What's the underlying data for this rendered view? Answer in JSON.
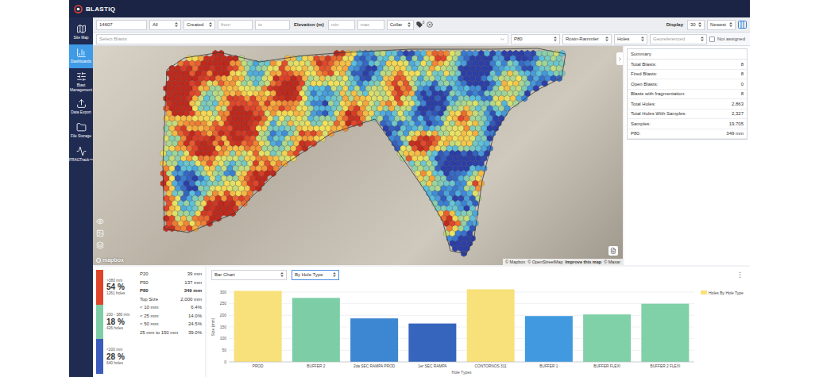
{
  "header": {
    "logo": "BLASTIQ"
  },
  "sidebar": {
    "items": [
      {
        "label": "Site Map",
        "selected": false
      },
      {
        "label": "Dashboards",
        "selected": true
      },
      {
        "label": "Blast Management",
        "selected": false
      },
      {
        "label": "Data Export",
        "selected": false
      },
      {
        "label": "File Storage",
        "selected": false
      },
      {
        "label": "FRAGTrack™",
        "selected": false
      }
    ]
  },
  "filters": {
    "search": "14607",
    "scope": "All",
    "date_field": "Created",
    "from_placeholder": "from",
    "to_placeholder": "to",
    "elevation_label": "Elevation (m)",
    "min_placeholder": "min",
    "max_placeholder": "max",
    "elevation_ref": "Collar",
    "tag_count": "0",
    "display_label": "Display",
    "page_size": "30",
    "sort": "Newest"
  },
  "options": {
    "blasts_placeholder": "Select Blasts",
    "metric": "P80",
    "model": "Rosin-Rammler",
    "level": "Holes",
    "georeferenced": {
      "label": "Georeferenced",
      "disabled": true
    },
    "not_assigned": {
      "label": "Not assigned",
      "checked": false
    }
  },
  "map": {
    "logo": "mapbox",
    "attribution": [
      {
        "text": "© Mapbox",
        "bold": false
      },
      {
        "text": "© OpenStreetMap",
        "bold": false
      },
      {
        "text": "Improve this map",
        "bold": true
      },
      {
        "text": "© Maxar",
        "bold": false
      }
    ]
  },
  "summary": {
    "title": "Summary",
    "rows": [
      {
        "label": "Total Blasts:",
        "value": "8"
      },
      {
        "label": "Fired Blasts:",
        "value": "8"
      },
      {
        "label": "Open Blasts:",
        "value": "0"
      },
      {
        "label": "Blasts with fragmentation:",
        "value": "8"
      },
      {
        "label": "Total Holes:",
        "value": "2,863"
      },
      {
        "label": "Total Holes With Samples:",
        "value": "2,327"
      },
      {
        "label": "Samples:",
        "value": "19,705"
      },
      {
        "label": "P80:",
        "value": "349 mm"
      }
    ]
  },
  "legend": {
    "groups": [
      {
        "range": ">380 mm",
        "share": "54 %",
        "holes": "1261 holes",
        "color": "#e0452b"
      },
      {
        "range": "200 - 380 mm",
        "share": "18 %",
        "holes": "426 holes",
        "color": "#7dcea6"
      },
      {
        "range": "<200 mm",
        "share": "28 %",
        "holes": "640 holes",
        "color": "#3b5bbd"
      }
    ]
  },
  "stats": [
    {
      "label": "P20",
      "value": "39 mm",
      "emphasis": false
    },
    {
      "label": "P50",
      "value": "137 mm",
      "emphasis": false
    },
    {
      "label": "P80",
      "value": "349 mm",
      "emphasis": true
    },
    {
      "label": "Top Size",
      "value": "2,000 mm",
      "emphasis": false
    },
    {
      "label": "< 10 mm",
      "value": "6.4%",
      "emphasis": false
    },
    {
      "label": "< 25 mm",
      "value": "14.0%",
      "emphasis": false
    },
    {
      "label": "< 50 mm",
      "value": "24.5%",
      "emphasis": false
    },
    {
      "label": "25 mm to 150 mm",
      "value": "39.0%",
      "emphasis": false
    }
  ],
  "chart": {
    "type": "Bar Chart",
    "group": {
      "label": "By Hole Type",
      "focused": true
    },
    "menu": "⋮",
    "y_title": "Size (mm)",
    "x_title": "Hole Types",
    "y_ticks": [
      "0",
      "50",
      "100",
      "150",
      "200",
      "250",
      "300"
    ],
    "series": {
      "name": "Holes By Hole Type",
      "color": "#f8e07a",
      "values": [
        305,
        275,
        187,
        165,
        312,
        197,
        204,
        250
      ]
    },
    "categories": [
      {
        "label": "PROD",
        "color": "#f8e07a"
      },
      {
        "label": "BUFFER 2",
        "color": "#7dcea6"
      },
      {
        "label": "2da SEC RAMPA PROD",
        "color": "#3d86d1"
      },
      {
        "label": "1er SEC RAMPA",
        "color": "#3565bd"
      },
      {
        "label": "CONTORNOS 311",
        "color": "#f8e07a"
      },
      {
        "label": "BUFFER 1",
        "color": "#419ae0"
      },
      {
        "label": "BUFFER FLEXI",
        "color": "#80d0a8"
      },
      {
        "label": "BUFFER 2 FLEXI",
        "color": "#80d0a8"
      }
    ]
  }
}
